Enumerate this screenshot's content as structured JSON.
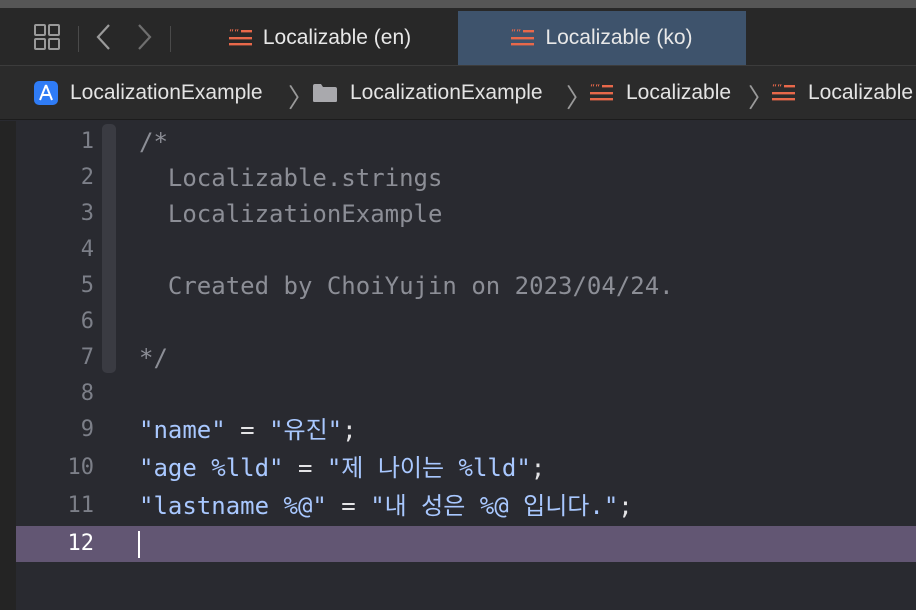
{
  "toolbar": {
    "grid_icon": "grid-icon",
    "back_icon": "chevron-left-icon",
    "forward_icon": "chevron-right-icon"
  },
  "tabs": [
    {
      "label": "Localizable (en)",
      "icon": "strings-file-icon",
      "active": false
    },
    {
      "label": "Localizable (ko)",
      "icon": "strings-file-icon",
      "active": true
    }
  ],
  "breadcrumb": [
    {
      "label": "LocalizationExample",
      "icon": "app-project-icon"
    },
    {
      "label": "LocalizationExample",
      "icon": "folder-icon"
    },
    {
      "label": "Localizable",
      "icon": "strings-file-icon"
    },
    {
      "label": "Localizable",
      "icon": "strings-file-icon"
    }
  ],
  "editor": {
    "lines": [
      {
        "num": "1",
        "text": "/*"
      },
      {
        "num": "2",
        "text": "  Localizable.strings"
      },
      {
        "num": "3",
        "text": "  LocalizationExample"
      },
      {
        "num": "4",
        "text": ""
      },
      {
        "num": "5",
        "text": "  Created by ChoiYujin on 2023/04/24."
      },
      {
        "num": "6",
        "text": ""
      },
      {
        "num": "7",
        "text": "*/"
      },
      {
        "num": "8",
        "text": ""
      },
      {
        "num": "9",
        "key": "\"name\"",
        "eq": " = ",
        "value": "\"유진\"",
        "end": ";"
      },
      {
        "num": "10",
        "key": "\"age %lld\"",
        "eq": " = ",
        "value": "\"제 나이는 %lld\"",
        "end": ";"
      },
      {
        "num": "11",
        "key": "\"lastname %@\"",
        "eq": " = ",
        "value": "\"내 성은 %@ 입니다.\"",
        "end": ";"
      },
      {
        "num": "12",
        "text": ""
      }
    ],
    "current_line": "12"
  },
  "colors": {
    "active_tab": "#3e536c",
    "current_line": "#625673",
    "string": "#a9c8ff",
    "comment": "#8c8e96",
    "strings_icon": "#e8684a"
  }
}
